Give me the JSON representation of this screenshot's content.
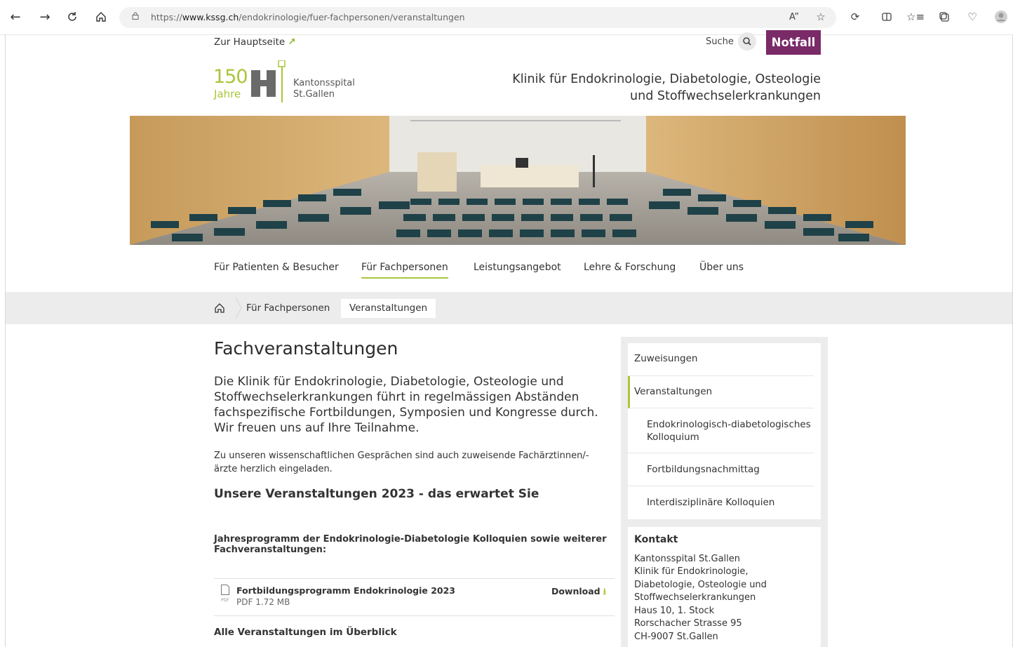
{
  "browser": {
    "url_prefix": "https://",
    "url_host": "www.kssg.ch",
    "url_path": "/endokrinologie/fuer-fachpersonen/veranstaltungen"
  },
  "topbar": {
    "home_link": "Zur Hauptseite",
    "search_label": "Suche",
    "emergency": "Notfall"
  },
  "logo": {
    "number": "150",
    "years": "Jahre",
    "line1": "Kantonsspital",
    "line2": "St.Gallen"
  },
  "clinic": {
    "line1": "Klinik für Endokrinologie, Diabetologie, Osteologie",
    "line2": "und Stoffwechselerkrankungen"
  },
  "nav": {
    "items": [
      "Für Patienten & Besucher",
      "Für Fachpersonen",
      "Leistungsangebot",
      "Lehre & Forschung",
      "Über uns"
    ]
  },
  "breadcrumb": {
    "items": [
      "Für Fachpersonen",
      "Veranstaltungen"
    ]
  },
  "main": {
    "title": "Fachveranstaltungen",
    "lead": "Die Klinik für Endokrinologie, Diabetologie, Osteologie und Stoffwechselerkrankungen führt in regelmässigen Abständen fachspezifische Fortbildungen, Symposien und Kongresse durch. Wir freuen uns auf Ihre Teilnahme.",
    "paragraph": "Zu unseren wissenschaftlichen Gesprächen sind auch zuweisende Fachärztinnen/-ärzte herzlich eingeladen.",
    "subtitle": "Unsere Veranstaltungen 2023 - das erwartet Sie",
    "program_heading": "Jahresprogramm der Endokrinologie-Diabetologie Kolloquien sowie weiterer Fachveranstaltungen:",
    "download": {
      "file_type_tag": "PDF",
      "title": "Fortbildungsprogramm Endokrinologie 2023",
      "size": "PDF 1.72 MB",
      "button": "Download"
    },
    "overview_heading": "Alle Veranstaltungen im Überblick"
  },
  "sidebar": {
    "items": [
      "Zuweisungen",
      "Veranstaltungen",
      "Endokrinologisch-diabetologisches Kolloquium",
      "Fortbildungsnachmittag",
      "Interdisziplinäre Kolloquien"
    ],
    "contact_title": "Kontakt",
    "contact_lines": [
      "Kantonsspital St.Gallen",
      "Klinik für Endokrinologie,",
      "Diabetologie, Osteologie und",
      "Stoffwechselerkrankungen",
      "Haus 10, 1. Stock",
      "Rorschacher Strasse 95",
      "CH-9007 St.Gallen"
    ]
  },
  "colors": {
    "accent_green": "#a9c63a",
    "emergency_purple": "#7a2a67"
  }
}
